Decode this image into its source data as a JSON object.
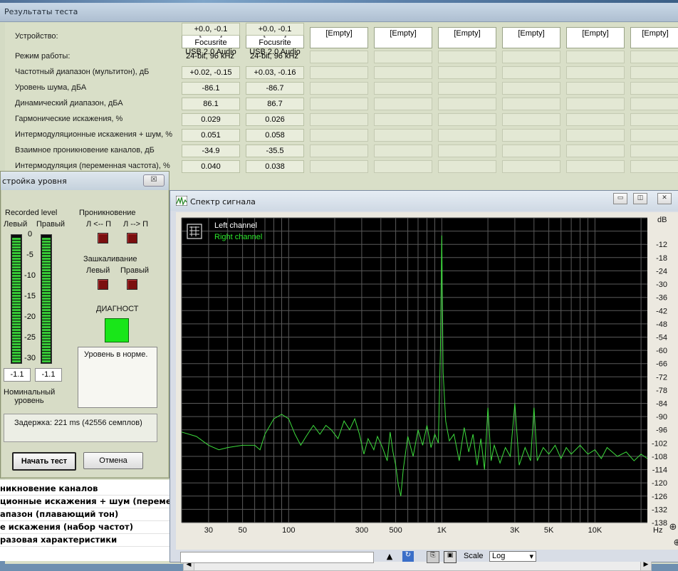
{
  "results_window": {
    "title": "Результаты теста",
    "row_labels": [
      "Устройство:",
      "Режим работы:",
      "Частотный диапазон (мультитон), дБ",
      "Уровень шума, дБА",
      "Динамический диапазон, дБА",
      "Гармонические искажения, %",
      "Интермодуляционные искажения + шум, %",
      "Взаимное проникновение каналов, дБ",
      "Интермодуляция (переменная частота), %"
    ],
    "devices": [
      {
        "line1": "[ASIO] Focusrite",
        "line2": "USB 2.0 Audio",
        "values": [
          "24-bit, 96 kHz",
          "+0.02, -0.15",
          "-86.1",
          "86.1",
          "0.029",
          "0.051",
          "-34.9",
          "0.040",
          "+0.0, -0.1"
        ]
      },
      {
        "line1": "[ASIO] Focusrite",
        "line2": "USB 2.0 Audio",
        "values": [
          "24-bit, 96 kHz",
          "+0.03, -0.16",
          "-86.7",
          "86.7",
          "0.026",
          "0.058",
          "-35.5",
          "0.038",
          "+0.0, -0.1"
        ]
      }
    ],
    "empty_slots": [
      "[Empty]",
      "[Empty]",
      "[Empty]",
      "[Empty]",
      "[Empty]",
      "[Empty]"
    ]
  },
  "level_window": {
    "title": "стройка уровня",
    "close_glyph": "☒",
    "recorded_level": "Recorded level",
    "left": "Левый",
    "right": "Правый",
    "scale": [
      "0",
      "-5",
      "-10",
      "-15",
      "-20",
      "-25",
      "-30"
    ],
    "left_readout": "-1.1",
    "right_readout": "-1.1",
    "nominal_line1": "Номинальный",
    "nominal_line2": "уровень",
    "crosstalk": "Проникновение",
    "crosstalk_lr": "Л <-- П",
    "crosstalk_rl": "Л --> П",
    "clipping": "Зашкаливание",
    "clip_left": "Левый",
    "clip_right": "Правый",
    "diagnostics": "ДИАГНОСТ",
    "status_message": "Уровень в норме.",
    "delay": "Задержка: 221 ms (42556 семплов)",
    "start_button": "Начать тест",
    "cancel_button": "Отмена"
  },
  "test_list": [
    "никновение каналов",
    "ционные искажения + шум (переменн",
    "апазон (плавающий тон)",
    "е искажения (набор частот)",
    "разовая характеристики"
  ],
  "spectrum_window": {
    "title": "Спектр сигнала",
    "minimize": "▭",
    "restore": "◫",
    "close": "✕",
    "unit_db": "dB",
    "unit_hz": "Hz",
    "legend_left": "Left channel",
    "legend_right": "Right channel",
    "scale_label": "Scale",
    "scale_value": "Log",
    "colors": {
      "plot_bg": "#000000",
      "grid": "#5a5a5a",
      "trace": "#3ddc3d",
      "legend_left": "#ffffff",
      "legend_right": "#2ce82c"
    }
  },
  "chart_data": {
    "type": "line",
    "title": "",
    "xlabel": "Hz",
    "ylabel": "dB",
    "x_scale": "log",
    "xlim": [
      20,
      22000
    ],
    "ylim": [
      -138,
      0
    ],
    "x_ticks": [
      {
        "v": 30,
        "label": "30"
      },
      {
        "v": 50,
        "label": "50"
      },
      {
        "v": 100,
        "label": "100"
      },
      {
        "v": 300,
        "label": "300"
      },
      {
        "v": 500,
        "label": "500"
      },
      {
        "v": 1000,
        "label": "1K"
      },
      {
        "v": 3000,
        "label": "3K"
      },
      {
        "v": 5000,
        "label": "5K"
      },
      {
        "v": 10000,
        "label": "10K"
      }
    ],
    "y_ticks": [
      -12,
      -18,
      -24,
      -30,
      -36,
      -42,
      -48,
      -54,
      -60,
      -66,
      -72,
      -78,
      -84,
      -90,
      -96,
      -102,
      -108,
      -114,
      -120,
      -126,
      -132,
      -138
    ],
    "grid": true,
    "legend_position": "top-left",
    "series": [
      {
        "name": "Left channel",
        "color": "#ffffff",
        "points": []
      },
      {
        "name": "Right channel",
        "color": "#3ddc3d",
        "points": [
          [
            20,
            -97
          ],
          [
            25,
            -99
          ],
          [
            30,
            -103
          ],
          [
            35,
            -105
          ],
          [
            40,
            -104
          ],
          [
            50,
            -103
          ],
          [
            60,
            -103
          ],
          [
            65,
            -105
          ],
          [
            70,
            -98
          ],
          [
            80,
            -91
          ],
          [
            90,
            -89
          ],
          [
            100,
            -91
          ],
          [
            110,
            -98
          ],
          [
            120,
            -103
          ],
          [
            130,
            -99
          ],
          [
            145,
            -94
          ],
          [
            160,
            -98
          ],
          [
            175,
            -94
          ],
          [
            190,
            -96
          ],
          [
            210,
            -100
          ],
          [
            230,
            -92
          ],
          [
            250,
            -96
          ],
          [
            270,
            -91
          ],
          [
            290,
            -98
          ],
          [
            310,
            -107
          ],
          [
            330,
            -100
          ],
          [
            360,
            -105
          ],
          [
            380,
            -99
          ],
          [
            410,
            -104
          ],
          [
            440,
            -110
          ],
          [
            460,
            -97
          ],
          [
            480,
            -106
          ],
          [
            500,
            -112
          ],
          [
            520,
            -121
          ],
          [
            540,
            -126
          ],
          [
            560,
            -114
          ],
          [
            600,
            -99
          ],
          [
            650,
            -108
          ],
          [
            700,
            -96
          ],
          [
            750,
            -103
          ],
          [
            800,
            -94
          ],
          [
            850,
            -104
          ],
          [
            900,
            -98
          ],
          [
            950,
            -102
          ],
          [
            980,
            -60
          ],
          [
            1000,
            -8
          ],
          [
            1020,
            -70
          ],
          [
            1060,
            -92
          ],
          [
            1120,
            -101
          ],
          [
            1200,
            -98
          ],
          [
            1300,
            -110
          ],
          [
            1400,
            -95
          ],
          [
            1500,
            -106
          ],
          [
            1600,
            -98
          ],
          [
            1700,
            -112
          ],
          [
            1800,
            -100
          ],
          [
            1900,
            -114
          ],
          [
            2000,
            -86
          ],
          [
            2100,
            -110
          ],
          [
            2200,
            -103
          ],
          [
            2400,
            -111
          ],
          [
            2600,
            -104
          ],
          [
            2800,
            -108
          ],
          [
            3000,
            -84
          ],
          [
            3200,
            -112
          ],
          [
            3500,
            -104
          ],
          [
            3800,
            -110
          ],
          [
            4000,
            -86
          ],
          [
            4200,
            -110
          ],
          [
            4600,
            -104
          ],
          [
            5000,
            -107
          ],
          [
            5500,
            -103
          ],
          [
            6000,
            -109
          ],
          [
            6500,
            -104
          ],
          [
            7000,
            -107
          ],
          [
            8000,
            -103
          ],
          [
            9000,
            -107
          ],
          [
            10000,
            -105
          ],
          [
            11000,
            -109
          ],
          [
            12000,
            -104
          ],
          [
            14000,
            -108
          ],
          [
            16000,
            -106
          ],
          [
            18000,
            -110
          ],
          [
            20000,
            -107
          ],
          [
            22000,
            -109
          ]
        ]
      }
    ]
  }
}
